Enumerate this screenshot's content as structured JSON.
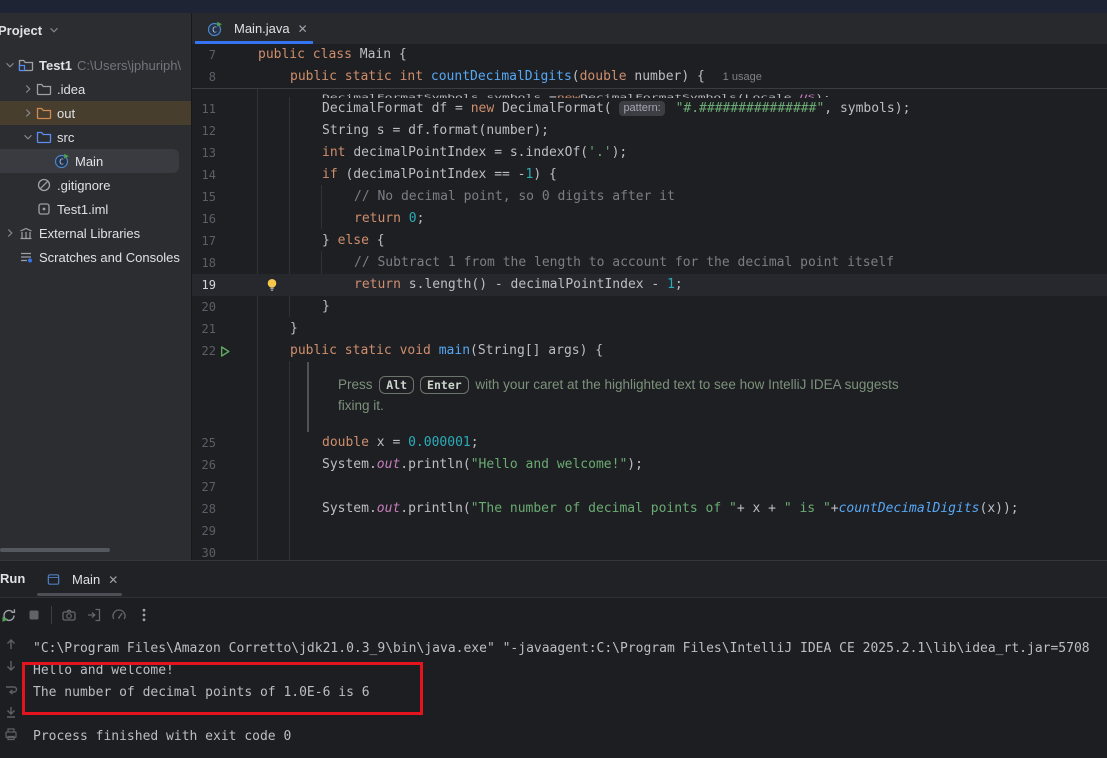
{
  "project_panel": {
    "header": {
      "title": "Project",
      "chevron_icon": "chevron-down"
    },
    "items": [
      {
        "label": "Test1",
        "path": "C:\\Users\\jphuriph\\",
        "icon": "project-folder",
        "chevron": "down",
        "level": 0,
        "bold": true
      },
      {
        "label": ".idea",
        "icon": "folder-gray",
        "chevron": "right",
        "level": 1
      },
      {
        "label": "out",
        "icon": "folder-orange",
        "chevron": "right",
        "level": 1,
        "state": "excluded"
      },
      {
        "label": "src",
        "icon": "folder-blue",
        "chevron": "down",
        "level": 1
      },
      {
        "label": "Main",
        "icon": "java-class",
        "level": 2,
        "state": "selected"
      },
      {
        "label": ".gitignore",
        "icon": "ignore-file",
        "level": 1
      },
      {
        "label": "Test1.iml",
        "icon": "iml-file",
        "level": 1
      },
      {
        "label": "External Libraries",
        "icon": "libraries",
        "chevron": "right",
        "level": 0
      },
      {
        "label": "Scratches and Consoles",
        "icon": "scratches",
        "level": 0
      }
    ]
  },
  "editor": {
    "tab": {
      "title": "Main.java",
      "icon": "java-class",
      "close": "✕"
    },
    "clipped_line_tokens": [
      {
        "s": "d",
        "t": "DecimalFormatSymbols symbols = "
      },
      {
        "s": "k",
        "t": "new "
      },
      {
        "s": "d",
        "t": "DecimalFormatSymbols(Locale."
      },
      {
        "s": "f",
        "t": "US"
      },
      {
        "s": "d",
        "t": ");"
      }
    ],
    "hint": {
      "pre": "Press",
      "key1": "Alt",
      "key2": "Enter",
      "mid": "with your caret at the highlighted text to see how IntelliJ IDEA suggests",
      "line2": "fixing it."
    },
    "lines": [
      {
        "num": "7",
        "ind": 0,
        "sticky": false,
        "tokens": [
          {
            "s": "k",
            "t": "public class "
          },
          {
            "s": "d",
            "t": "Main {"
          }
        ]
      },
      {
        "num": "8",
        "ind": 1,
        "stickyLast": true,
        "tokens": [
          {
            "s": "k",
            "t": "public static int "
          },
          {
            "s": "fd",
            "t": "countDecimalDigits"
          },
          {
            "s": "d",
            "t": "("
          },
          {
            "s": "k",
            "t": "double"
          },
          {
            "s": "d",
            "t": " number) { "
          },
          {
            "s": "usage",
            "t": "1 usage"
          }
        ]
      },
      {
        "special": "clipped"
      },
      {
        "num": "11",
        "ind": 2,
        "tokens": [
          {
            "s": "d",
            "t": "DecimalFormat df = "
          },
          {
            "s": "k",
            "t": "new "
          },
          {
            "s": "d",
            "t": "DecimalFormat( "
          },
          {
            "s": "chip",
            "t": "pattern:"
          },
          {
            "s": "s",
            "t": " \"#.###############\""
          },
          {
            "s": "d",
            "t": ", symbols);"
          }
        ]
      },
      {
        "num": "12",
        "ind": 2,
        "tokens": [
          {
            "s": "d",
            "t": "String s = df.format(number);"
          }
        ]
      },
      {
        "num": "13",
        "ind": 2,
        "tokens": [
          {
            "s": "k",
            "t": "int "
          },
          {
            "s": "d",
            "t": "decimalPointIndex = s.indexOf("
          },
          {
            "s": "s",
            "t": "'.'"
          },
          {
            "s": "d",
            "t": ");"
          }
        ]
      },
      {
        "num": "14",
        "ind": 2,
        "tokens": [
          {
            "s": "k",
            "t": "if "
          },
          {
            "s": "d",
            "t": "(decimalPointIndex == -"
          },
          {
            "s": "n",
            "t": "1"
          },
          {
            "s": "d",
            "t": ") {"
          }
        ]
      },
      {
        "num": "15",
        "ind": 3,
        "tokens": [
          {
            "s": "c",
            "t": "// No decimal point, so 0 digits after it"
          }
        ]
      },
      {
        "num": "16",
        "ind": 3,
        "tokens": [
          {
            "s": "k",
            "t": "return "
          },
          {
            "s": "n",
            "t": "0"
          },
          {
            "s": "d",
            "t": ";"
          }
        ]
      },
      {
        "num": "17",
        "ind": 2,
        "tokens": [
          {
            "s": "d",
            "t": "} "
          },
          {
            "s": "k",
            "t": "else"
          },
          {
            "s": "d",
            "t": " {"
          }
        ]
      },
      {
        "num": "18",
        "ind": 3,
        "tokens": [
          {
            "s": "c",
            "t": "// Subtract 1 from the length to account for the decimal point itself"
          }
        ]
      },
      {
        "num": "19",
        "ind": 3,
        "current": true,
        "gutter_icon": "lightbulb",
        "tokens": [
          {
            "s": "k",
            "t": "return "
          },
          {
            "s": "d",
            "t": "s.length() - decimalPointIndex - "
          },
          {
            "s": "n",
            "t": "1"
          },
          {
            "s": "d",
            "t": ";"
          }
        ]
      },
      {
        "num": "20",
        "ind": 2,
        "tokens": [
          {
            "s": "d",
            "t": "}"
          }
        ]
      },
      {
        "num": "21",
        "ind": 1,
        "tokens": [
          {
            "s": "d",
            "t": "}"
          }
        ]
      },
      {
        "num": "22",
        "ind": 1,
        "gutter_icon": "run-arrow",
        "tokens": [
          {
            "s": "k",
            "t": "public static void "
          },
          {
            "s": "fd",
            "t": "main"
          },
          {
            "s": "d",
            "t": "(String[] args) {"
          }
        ]
      },
      {
        "special": "hint"
      },
      {
        "num": "25",
        "ind": 2,
        "tokens": [
          {
            "s": "k",
            "t": "double "
          },
          {
            "s": "d",
            "t": "x = "
          },
          {
            "s": "n",
            "t": "0.000001"
          },
          {
            "s": "d",
            "t": ";"
          }
        ]
      },
      {
        "num": "26",
        "ind": 2,
        "tokens": [
          {
            "s": "d",
            "t": "System."
          },
          {
            "s": "f",
            "t": "out"
          },
          {
            "s": "d",
            "t": ".println("
          },
          {
            "s": "s",
            "t": "\"Hello and welcome!\""
          },
          {
            "s": "d",
            "t": ");"
          }
        ]
      },
      {
        "num": "27",
        "ind": 2,
        "tokens": []
      },
      {
        "num": "28",
        "ind": 2,
        "tokens": [
          {
            "s": "d",
            "t": "System."
          },
          {
            "s": "f",
            "t": "out"
          },
          {
            "s": "d",
            "t": ".println("
          },
          {
            "s": "s",
            "t": "\"The number of decimal points of \""
          },
          {
            "s": "d",
            "t": "+ x + "
          },
          {
            "s": "s",
            "t": "\" is \""
          },
          {
            "s": "d",
            "t": "+"
          },
          {
            "s": "fi",
            "t": "countDecimalDigits"
          },
          {
            "s": "d",
            "t": "(x));"
          }
        ]
      },
      {
        "num": "29",
        "ind": 2,
        "tokens": []
      },
      {
        "num": "30",
        "ind": 2,
        "tokens": []
      }
    ]
  },
  "run_panel": {
    "title": "Run",
    "tab": {
      "label": "Main",
      "icon": "run-tab",
      "close": "✕"
    },
    "toolbar": [
      {
        "name": "rerun"
      },
      {
        "name": "stop"
      },
      {
        "sep": true
      },
      {
        "name": "thread-dump-camera"
      },
      {
        "name": "attach-debugger"
      },
      {
        "name": "profiler-gauge"
      },
      {
        "name": "more-kebab"
      }
    ],
    "console": {
      "gutter_icons": [
        "prev-occurrence",
        "next-occurrence",
        "soft-wrap",
        "scroll-to-end",
        "print"
      ],
      "lines": [
        "\"C:\\Program Files\\Amazon Corretto\\jdk21.0.3_9\\bin\\java.exe\" \"-javaagent:C:\\Program Files\\IntelliJ IDEA CE 2025.2.1\\lib\\idea_rt.jar=5708",
        "Hello and welcome!",
        "The number of decimal points of 1.0E-6 is 6",
        "",
        "Process finished with exit code 0"
      ],
      "annotation_color": "#e3141e"
    }
  }
}
